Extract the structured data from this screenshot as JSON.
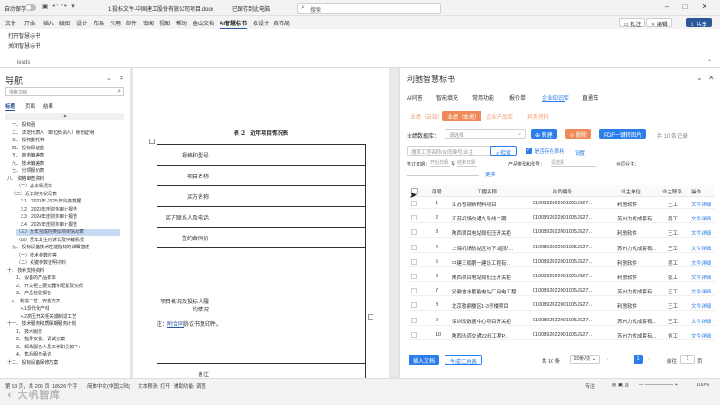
{
  "titlebar": {
    "autosave": "自动保存",
    "doc_title": "1.投标文件-中国建工股份有限公司项目.docx",
    "saved": "已保存到此电脑",
    "search_placeholder": "搜索"
  },
  "menu": {
    "items": [
      "文件",
      "开始",
      "插入",
      "绘图",
      "设计",
      "布局",
      "引用",
      "邮件",
      "审阅",
      "视图",
      "帮助",
      "金山文档",
      "AI智慧标书",
      "表设计",
      "表布局"
    ],
    "active_index": 12,
    "comment": "批注",
    "edit": "编辑",
    "share": "共享"
  },
  "ribbon": {
    "open_label": "打开智慧标书",
    "close_label": "关闭智慧标书",
    "group": "leads"
  },
  "nav": {
    "title": "导航",
    "search_placeholder": "搜索文档",
    "tabs": [
      "标题",
      "页面",
      "结果"
    ],
    "collapse": "▲",
    "items": [
      {
        "text": "一、 投标函",
        "indent": 1
      },
      {
        "text": "二、 法定代表人（单位负责人）身份证明",
        "indent": 1
      },
      {
        "text": "三、 授权委托书",
        "indent": 1
      },
      {
        "text": "四、 投标保证金",
        "indent": 1
      },
      {
        "text": "五、 商务偏差表",
        "indent": 1
      },
      {
        "text": "六、 技术偏差表",
        "indent": 1
      },
      {
        "text": "七、 分项报价表",
        "indent": 1
      },
      {
        "text": "八、 资格审查资料",
        "indent": 0
      },
      {
        "text": "（一）基本情况表",
        "indent": 2
      },
      {
        "text": "（二）近年财务状况表",
        "indent": 1
      },
      {
        "text": "2.1　2023年-2025 年财务数据",
        "indent": 3
      },
      {
        "text": "2.2　2023年度财务审计报告",
        "indent": 3
      },
      {
        "text": "2.3　2024年度财务审计报告",
        "indent": 3
      },
      {
        "text": "2.4　2025年度财务审计报告",
        "indent": 3
      },
      {
        "text": "（三）近年完成的类似项目情况表",
        "indent": 2,
        "selected": true
      },
      {
        "text": "（四）近年发生的诉讼及仲裁情况",
        "indent": 2
      },
      {
        "text": "九、 投标设备技术性能指标的详细描述",
        "indent": 1
      },
      {
        "text": "（一）技术参数应答",
        "indent": 2
      },
      {
        "text": "（二）关键参数证明材料",
        "indent": 2
      },
      {
        "text": "十、 技术支持资料",
        "indent": 0
      },
      {
        "text": "1、 设备的产品样本",
        "indent": 2
      },
      {
        "text": "2、 开关柜主要元器件配置及资质",
        "indent": 2
      },
      {
        "text": "3、 产品检验报告",
        "indent": 2
      },
      {
        "text": "4、 制造工艺、安装方案",
        "indent": 1
      },
      {
        "text": "4.1现代化产线",
        "indent": 3
      },
      {
        "text": "4.2高压开关柜关键制造工艺",
        "indent": 3
      },
      {
        "text": "十一、 技术服务和质保期服务计划",
        "indent": 0
      },
      {
        "text": "1、 技术服务",
        "indent": 2
      },
      {
        "text": "2、 指导安装、调试方案",
        "indent": 2
      },
      {
        "text": "3、 现场服务人员工作职责如下：",
        "indent": 2
      },
      {
        "text": "4、 售后服务承诺",
        "indent": 2
      },
      {
        "text": "十二、 投标设备保修方案",
        "indent": 0
      }
    ]
  },
  "document": {
    "title": "表 2　近年项目情况表",
    "rows": [
      "规格和型号",
      "项目名称",
      "买方名称",
      "买方联系人及电话",
      "签约合同价",
      "项目概况及投标人履约情况",
      "备注"
    ],
    "note_prefix": "注：",
    "note_link": "附合同",
    "note_suffix": "协议书复印件。"
  },
  "panel": {
    "title": "利驰智慧标书",
    "tabs": [
      "AI问答",
      "智能填充",
      "常用功能",
      "报价单",
      "企业知识库",
      "直通车"
    ],
    "active_tab": 4,
    "subtabs": [
      "业绩（云端）",
      "业绩（本地）",
      "企业产品库",
      "异质资料"
    ],
    "active_subtab": 1,
    "db_label": "业绩数据库：",
    "db_placeholder": "请选择",
    "new_btn": "新建",
    "del_btn": "删除",
    "pdf_btn": "PDF一键转图片",
    "record_count": "共 10 条记录",
    "search_placeholder": "搜索工程名称/合同编号/业主",
    "search_btn": "检索",
    "hide_label": "是否存在表格",
    "settings": "设置",
    "sign_date_label": "签订日期：",
    "start_date": "开始日期",
    "to": "至",
    "end_date": "结束日期",
    "product_label": "产品类型和型号：",
    "product_placeholder": "请选择",
    "region_label": "合同业主：",
    "more": "更多",
    "columns": [
      "序号",
      "工程名称",
      "合同编号",
      "业主单位",
      "业主联系",
      "操作"
    ],
    "rows": [
      {
        "no": "1",
        "name": "江苏省钢新材料项目",
        "code": "0100892022001005JS27...",
        "owner": "利驰软件",
        "contact": "王工",
        "op": "文件详细"
      },
      {
        "no": "2",
        "name": "江苏机场交通九号线二期...",
        "code": "0100892022001005JS27...",
        "owner": "苏州力优成套有...",
        "contact": "吴工",
        "op": "文件详细"
      },
      {
        "no": "3",
        "name": "陕西项目电站局低压开关柜",
        "code": "0100892022001005JS27...",
        "owner": "利驰软件",
        "contact": "王工",
        "op": "文件详细"
      },
      {
        "no": "4",
        "name": "上海机场航站区地下1层防...",
        "code": "0100892022001005JS27...",
        "owner": "苏州力优成套有...",
        "contact": "王工",
        "op": "文件详细"
      },
      {
        "no": "5",
        "name": "中建三局第一建设工程有...",
        "code": "0100892022001005JS27...",
        "owner": "利驰软件",
        "contact": "吴工",
        "op": "文件详细"
      },
      {
        "no": "6",
        "name": "陕西项目电站局低压开关柜",
        "code": "0100892022001005JS27...",
        "owner": "利驰软件",
        "contact": "张工",
        "op": "文件详细"
      },
      {
        "no": "7",
        "name": "安徽池水蓄能电站厂用电工程",
        "code": "0100892022001005JS27...",
        "owner": "苏州力优成套有...",
        "contact": "王工",
        "op": "文件详细"
      },
      {
        "no": "8",
        "name": "北京歌鼎楼区1-3号楼项目",
        "code": "0100892022001005JS27...",
        "owner": "利驰软件",
        "contact": "王工",
        "op": "文件详细"
      },
      {
        "no": "9",
        "name": "深圳云数据中心项目开关柜",
        "code": "0100892022001005JS27...",
        "owner": "苏州力优成套有...",
        "contact": "王工",
        "op": "文件详细"
      },
      {
        "no": "10",
        "name": "陕西轨道交通22线工程P...",
        "code": "0100892022001005JS27...",
        "owner": "苏州力优成套有...",
        "contact": "刘工",
        "op": "文件详细"
      }
    ],
    "insert_btn": "插入文档",
    "gen_btn": "生成汇总表",
    "total": "共 10 条",
    "page_size": "20条/页",
    "current_page": "1",
    "goto_label": "前往",
    "goto_value": "1",
    "page_unit": "页"
  },
  "status": {
    "items": [
      "第 53 页，共 206 页",
      "18526 个字",
      "简体中文(中国大陆)",
      "文本预测: 打开",
      "辅助功能: 调查",
      "专注",
      "100%"
    ],
    "watermark": "大帆智库"
  }
}
